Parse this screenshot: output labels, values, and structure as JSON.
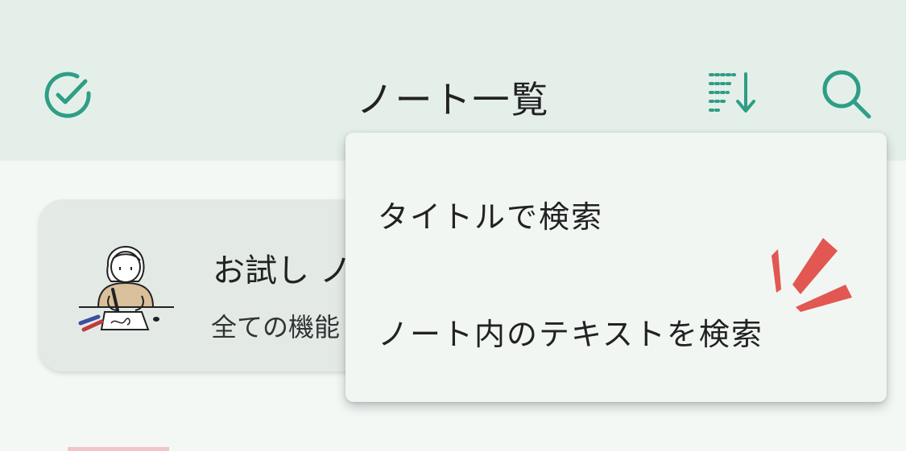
{
  "header": {
    "title": "ノート一覧"
  },
  "card": {
    "title": "お試し ノ",
    "subtitle": "全ての機能"
  },
  "menu": {
    "items": [
      {
        "label": "タイトルで検索"
      },
      {
        "label": "ノート内のテキストを検索"
      }
    ]
  },
  "icons": [
    "check-circle-icon",
    "sort-icon",
    "search-icon"
  ],
  "colors": {
    "accent": "#2e9e85",
    "header_bg": "#e5efea",
    "menu_bg": "#f1f6f3",
    "spark": "#e0463f"
  }
}
